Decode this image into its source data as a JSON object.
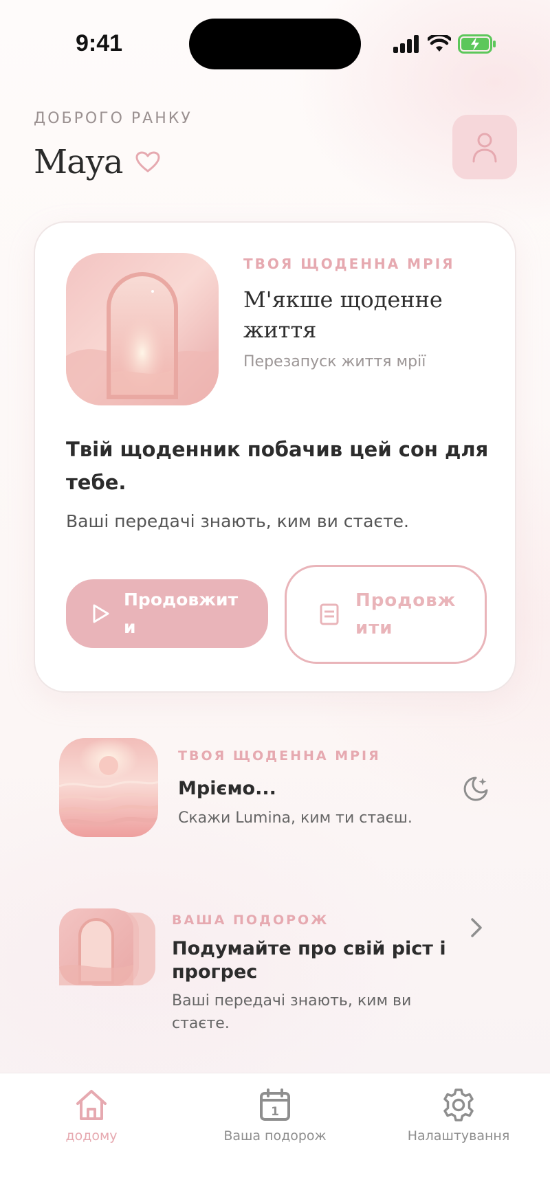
{
  "status_bar": {
    "time": "9:41"
  },
  "header": {
    "greeting": "ДОБРОГО РАНКУ",
    "user_name": "Maya"
  },
  "featured_card": {
    "label": "ТВОЯ ЩОДЕННА МРІЯ",
    "title": "М'якше щоденне життя",
    "subtitle": "Перезапуск життя мрії",
    "heading": "Твій щоденник побачив цей сон для тебе.",
    "description": "Ваші передачі знають, ким ви стаєте.",
    "primary_button": "Продовжити",
    "secondary_button": "Продовжити"
  },
  "list": [
    {
      "label": "ТВОЯ ЩОДЕННА МРІЯ",
      "title": "Мрiємо...",
      "subtitle": "Скажи Lumina, ким ти стаєш.",
      "trailing_icon": "moon-stars-icon"
    },
    {
      "label": "ВАША ПОДОРОЖ",
      "title": "Подумайте про свій ріст і прогрес",
      "subtitle": "Ваші передачі знають, ким ви стаєте.",
      "trailing_icon": "chevron-right-icon"
    }
  ],
  "tabbar": {
    "tabs": [
      {
        "label": "додому",
        "icon": "home-icon",
        "active": true
      },
      {
        "label": "Ваша подорож",
        "icon": "calendar-icon",
        "active": false
      },
      {
        "label": "Налаштування",
        "icon": "gear-icon",
        "active": false
      }
    ]
  },
  "colors": {
    "accent": "#e9b4b9",
    "accent_text": "#e6a9b0",
    "text": "#2c2c2c"
  }
}
